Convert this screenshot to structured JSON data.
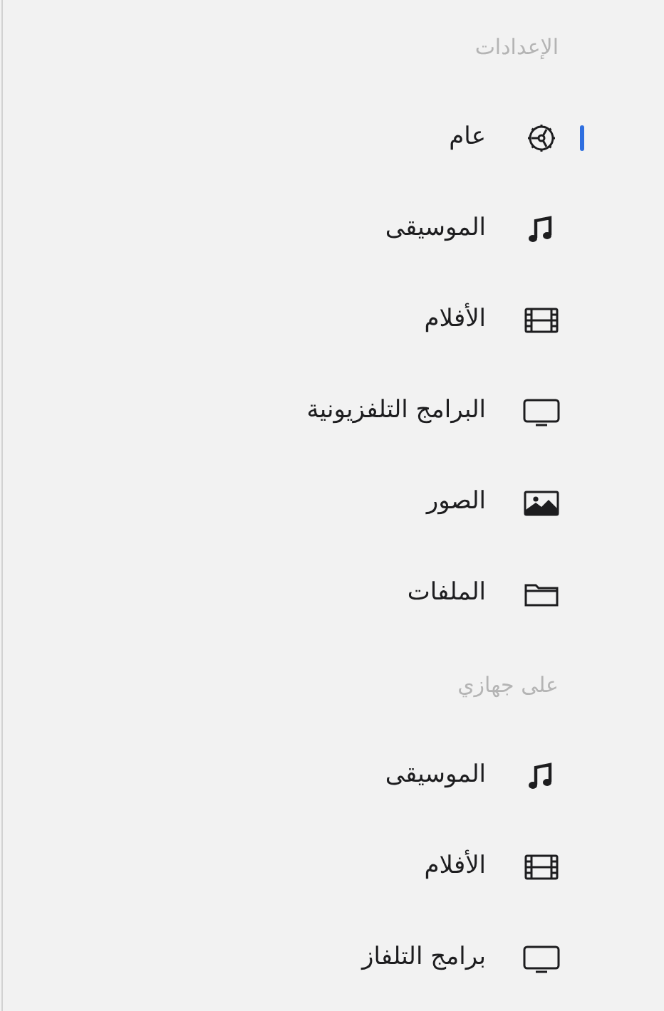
{
  "sections": [
    {
      "title": "الإعدادات",
      "items": [
        {
          "label": "عام",
          "kind": "gear",
          "selected": true
        },
        {
          "label": "الموسيقى",
          "kind": "music",
          "selected": false
        },
        {
          "label": "الأفلام",
          "kind": "film",
          "selected": false
        },
        {
          "label": "البرامج التلفزيونية",
          "kind": "tv",
          "selected": false
        },
        {
          "label": "الصور",
          "kind": "photo",
          "selected": false
        },
        {
          "label": "الملفات",
          "kind": "folder",
          "selected": false
        }
      ]
    },
    {
      "title": "على جهازي",
      "items": [
        {
          "label": "الموسيقى",
          "kind": "music",
          "selected": false
        },
        {
          "label": "الأفلام",
          "kind": "film",
          "selected": false
        },
        {
          "label": "برامج التلفاز",
          "kind": "tv",
          "selected": false
        }
      ]
    }
  ]
}
